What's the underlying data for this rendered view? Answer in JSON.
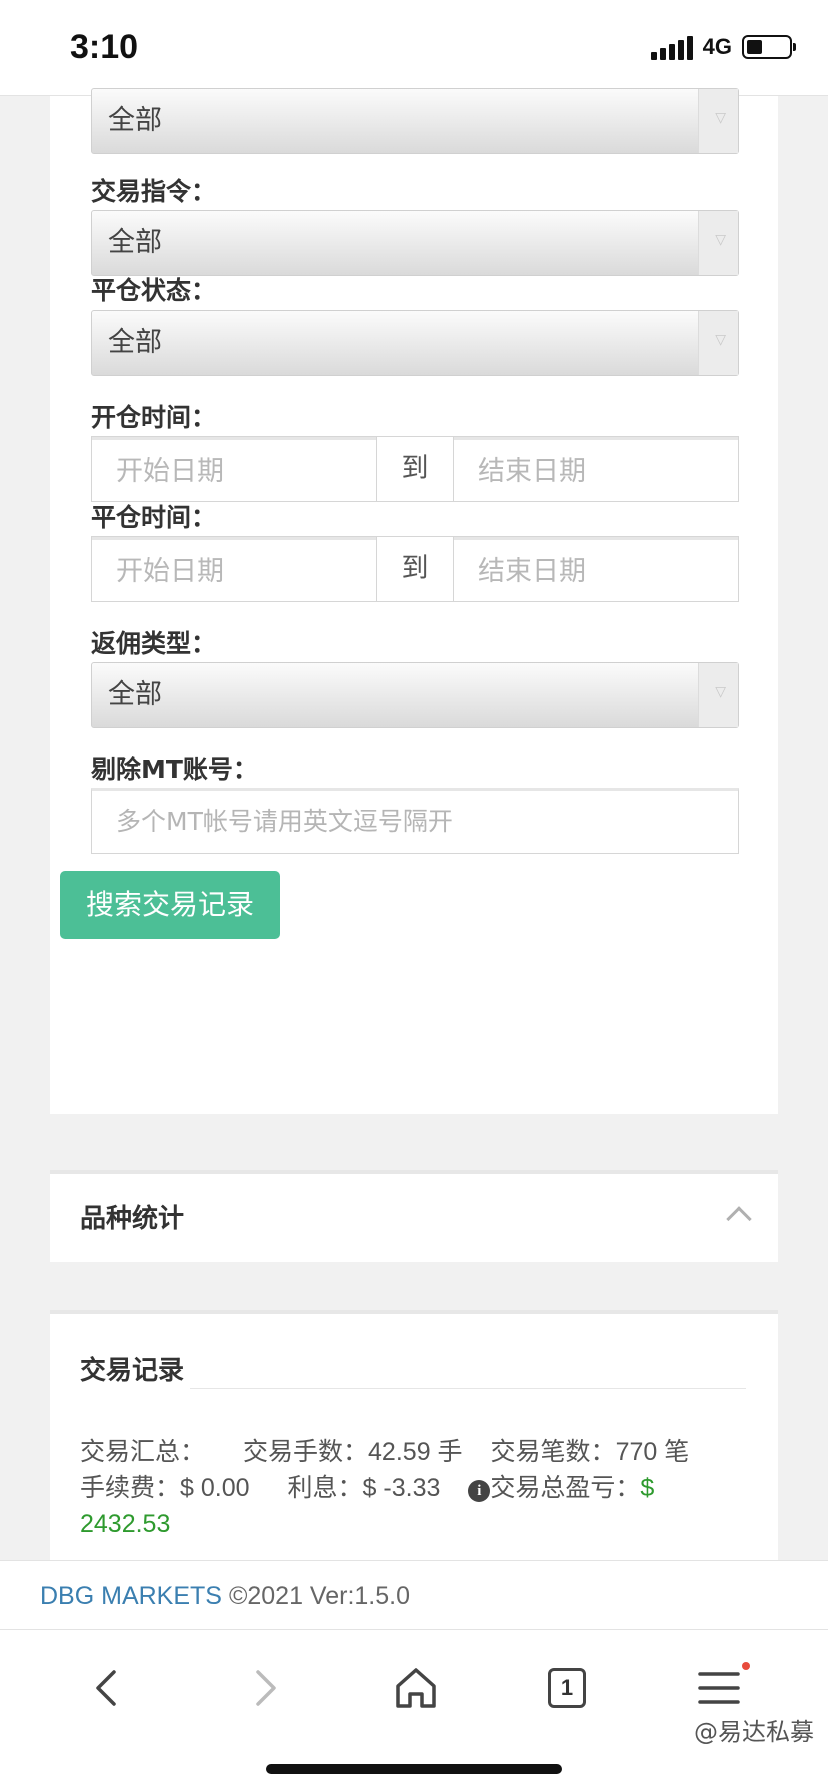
{
  "status_bar": {
    "time": "3:10",
    "network": "4G"
  },
  "filters": {
    "first_select": {
      "value": "全部"
    },
    "trade_command": {
      "label": "交易指令：",
      "value": "全部"
    },
    "close_status": {
      "label": "平仓状态：",
      "value": "全部"
    },
    "open_time": {
      "label": "开仓时间：",
      "start_placeholder": "开始日期",
      "to": "到",
      "end_placeholder": "结束日期"
    },
    "close_time": {
      "label": "平仓时间：",
      "start_placeholder": "开始日期",
      "to": "到",
      "end_placeholder": "结束日期"
    },
    "rebate_type": {
      "label": "返佣类型：",
      "value": "全部"
    },
    "exclude_mt": {
      "label": "剔除MT账号：",
      "placeholder": "多个MT帐号请用英文逗号隔开"
    },
    "search_button": "搜索交易记录"
  },
  "stats": {
    "title": "品种统计"
  },
  "records": {
    "title": "交易记录",
    "summary_label": "交易汇总：",
    "lots_label": "交易手数：",
    "lots_value": "42.59 手",
    "count_label": "交易笔数：",
    "count_value": "770 笔",
    "fee_label": "手续费：",
    "fee_value": "$ 0.00",
    "interest_label": "利息：",
    "interest_value": "$ -3.33",
    "pnl_label": "交易总盈亏：",
    "pnl_value": "$ 2432.53"
  },
  "footer": {
    "brand": "DBG MARKETS",
    "copyright": "©2021 Ver:1.5.0"
  },
  "browser": {
    "tab_count": "1"
  },
  "watermark": "@易达私募",
  "colors": {
    "accent": "#4cbf96",
    "profit": "#2e9a2e",
    "brand_link": "#3b7fb0"
  }
}
